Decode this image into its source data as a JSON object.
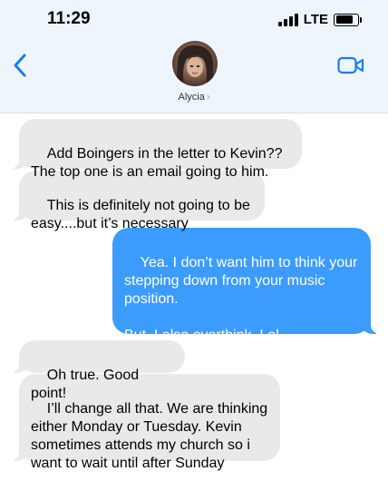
{
  "status_bar": {
    "time": "11:29",
    "network": "LTE",
    "battery_level": 0.9
  },
  "header": {
    "contact_name": "Alycia",
    "chevron": "›",
    "back_icon": "chevron-left-icon",
    "video_icon": "video-camera-icon",
    "accent_color": "#1a7cf4"
  },
  "messages": [
    {
      "direction": "incoming",
      "text": "Add Boingers in the letter to Kevin??\nThe top one is an email going to him."
    },
    {
      "direction": "incoming",
      "text": "This is definitely not going to be\neasy....but it’s necessary"
    },
    {
      "direction": "outgoing",
      "text": "Yea. I don’t want him to think your\nstepping down from your music\nposition.\n\nBut. I also overthink. Lol"
    },
    {
      "direction": "incoming",
      "text": "Oh true. Good point!"
    },
    {
      "direction": "incoming",
      "text": "I’ll change all that. We are thinking\neither Monday or Tuesday. Kevin\nsometimes attends my church so i\nwant to wait until after Sunday"
    }
  ],
  "colors": {
    "incoming_bubble": "#e9e9eb",
    "outgoing_bubble": "#3b9cfd",
    "header_background": "#eef5fc"
  }
}
